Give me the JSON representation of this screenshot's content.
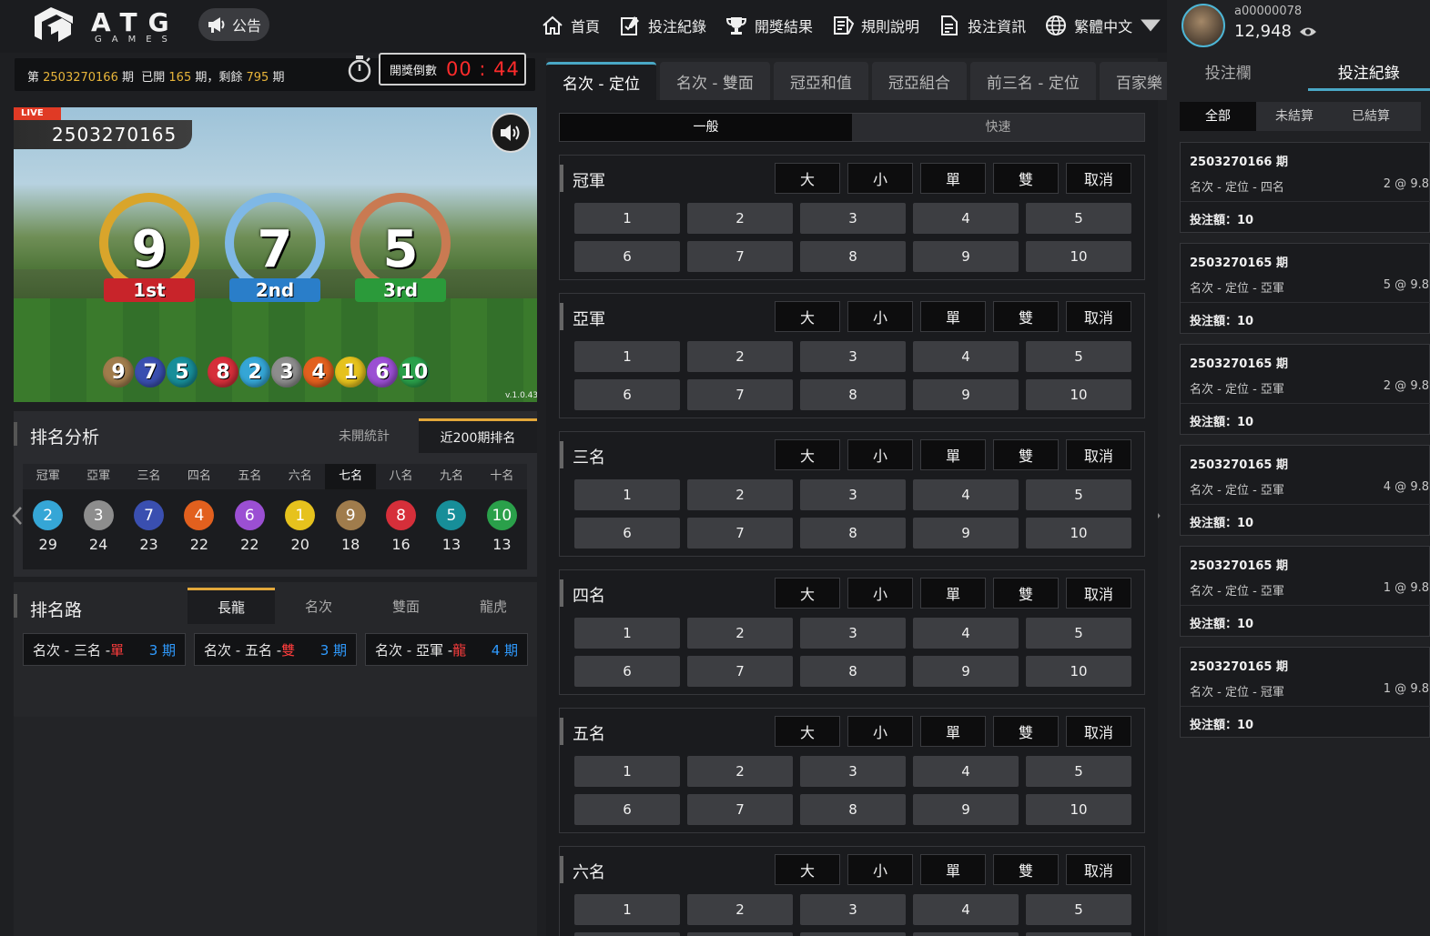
{
  "brand": {
    "word": "ATG",
    "sub": "GAMES"
  },
  "notice_label": "公告",
  "nav": [
    {
      "label": "首頁",
      "icon": "home-icon"
    },
    {
      "label": "投注紀錄",
      "icon": "bet-record-icon"
    },
    {
      "label": "開獎結果",
      "icon": "trophy-icon"
    },
    {
      "label": "規則說明",
      "icon": "rules-icon"
    },
    {
      "label": "投注資訊",
      "icon": "info-doc-icon"
    },
    {
      "label": "繁體中文",
      "icon": "globe-icon"
    }
  ],
  "draw_info": {
    "prefix": "第 ",
    "period": "2503270166",
    "period_suffix": " 期",
    "opened_prefix": "已開 ",
    "opened": "165",
    "opened_suffix": " 期，",
    "remain_prefix": "剩餘 ",
    "remain": "795",
    "remain_suffix": " 期"
  },
  "countdown": {
    "label": "開獎倒數",
    "value": "00 : 44"
  },
  "video": {
    "live": "LIVE",
    "period": "2503270165",
    "version": "v.1.0.43",
    "podium": [
      {
        "number": "9",
        "place": "1st",
        "color": "#c8242a"
      },
      {
        "number": "7",
        "place": "2nd",
        "color": "#2a7ec9"
      },
      {
        "number": "5",
        "place": "3rd",
        "color": "#2b9a3a"
      }
    ],
    "results": [
      "9",
      "7",
      "5",
      "8",
      "2",
      "3",
      "4",
      "1",
      "6",
      "10"
    ]
  },
  "ball_colors": {
    "1": "#e6c21d",
    "2": "#35a6d6",
    "3": "#8d8d8d",
    "4": "#e2601e",
    "5": "#178e99",
    "6": "#9b4fd3",
    "7": "#3a4fb0",
    "8": "#d62f3a",
    "9": "#a07c4c",
    "10": "#2aa04a"
  },
  "rank_analysis": {
    "title": "排名分析",
    "tabs": [
      "未開統計",
      "近200期排名"
    ],
    "headers": [
      "冠軍",
      "亞軍",
      "三名",
      "四名",
      "五名",
      "六名",
      "七名",
      "八名",
      "九名",
      "十名"
    ],
    "selected_header": 6,
    "values": [
      {
        "ball": "2",
        "count": "29"
      },
      {
        "ball": "3",
        "count": "24"
      },
      {
        "ball": "7",
        "count": "23"
      },
      {
        "ball": "4",
        "count": "22"
      },
      {
        "ball": "6",
        "count": "22"
      },
      {
        "ball": "1",
        "count": "20"
      },
      {
        "ball": "9",
        "count": "18"
      },
      {
        "ball": "8",
        "count": "16"
      },
      {
        "ball": "5",
        "count": "13"
      },
      {
        "ball": "10",
        "count": "13"
      }
    ]
  },
  "rank_road": {
    "title": "排名路",
    "tabs": [
      "長龍",
      "名次",
      "雙面",
      "龍虎"
    ],
    "items": [
      {
        "label": "名次 - 三名 - ",
        "hit": "單",
        "count": "3 期"
      },
      {
        "label": "名次 - 五名 - ",
        "hit": "雙",
        "count": "3 期"
      },
      {
        "label": "名次 - 亞軍 - ",
        "hit": "龍",
        "count": "4 期"
      }
    ]
  },
  "bet_tabs": [
    "名次 - 定位",
    "名次 - 雙面",
    "冠亞和值",
    "冠亞組合",
    "前三名 - 定位",
    "百家樂"
  ],
  "modes": [
    "一般",
    "快速"
  ],
  "bet_options": [
    "大",
    "小",
    "單",
    "雙",
    "取消"
  ],
  "numbers": [
    "1",
    "2",
    "3",
    "4",
    "5",
    "6",
    "7",
    "8",
    "9",
    "10"
  ],
  "positions": [
    "冠軍",
    "亞軍",
    "三名",
    "四名",
    "五名",
    "六名"
  ],
  "user": {
    "name": "a00000078",
    "balance": "12,948"
  },
  "right_tabs": [
    "投注欄",
    "投注紀錄"
  ],
  "filters": [
    "全部",
    "未結算",
    "已結算"
  ],
  "records": [
    {
      "period": "2503270166 期",
      "type": "名次 - 定位 - 四名",
      "odds": "2 @ 9.8",
      "amount": "投注額：10"
    },
    {
      "period": "2503270165 期",
      "type": "名次 - 定位 - 亞軍",
      "odds": "5 @ 9.8",
      "amount": "投注額：10"
    },
    {
      "period": "2503270165 期",
      "type": "名次 - 定位 - 亞軍",
      "odds": "2 @ 9.8",
      "amount": "投注額：10"
    },
    {
      "period": "2503270165 期",
      "type": "名次 - 定位 - 亞軍",
      "odds": "4 @ 9.8",
      "amount": "投注額：10"
    },
    {
      "period": "2503270165 期",
      "type": "名次 - 定位 - 亞軍",
      "odds": "1 @ 9.8",
      "amount": "投注額：10"
    },
    {
      "period": "2503270165 期",
      "type": "名次 - 定位 - 冠軍",
      "odds": "1 @ 9.8",
      "amount": "投注額：10"
    }
  ]
}
